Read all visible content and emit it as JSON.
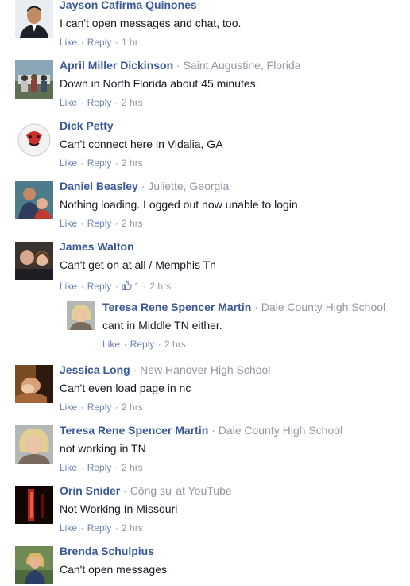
{
  "colors": {
    "author": "#3b5998",
    "meta": "#9197a3",
    "link": "#6d84b4",
    "text": "#141823"
  },
  "comments": [
    {
      "author": "Jayson Cafirma Quinones",
      "meta": "",
      "text": "I can't open messages and chat, too.",
      "like": "Like",
      "reply": "Reply",
      "time": "1 hr",
      "avatar": "man-in-suit"
    },
    {
      "author": "April Miller Dickinson",
      "meta": "Saint Augustine, Florida",
      "text": "Down in North Florida about 45 minutes.",
      "like": "Like",
      "reply": "Reply",
      "time": "2 hrs",
      "avatar": "outdoor-group"
    },
    {
      "author": "Dick Petty",
      "meta": "",
      "text": "Can't connect here in Vidalia, GA",
      "like": "Like",
      "reply": "Reply",
      "time": "2 hrs",
      "avatar": "volleyball-face"
    },
    {
      "author": "Daniel Beasley",
      "meta": "Juliette, Georgia",
      "text": "Nothing loading. Logged out now unable to login",
      "like": "Like",
      "reply": "Reply",
      "time": "2 hrs",
      "avatar": "man-with-child"
    },
    {
      "author": "James Walton",
      "meta": "",
      "text": "Can't get on at all / Memphis Tn",
      "like": "Like",
      "reply": "Reply",
      "time": "2 hrs",
      "avatar": "couple",
      "likes": "1"
    },
    {
      "author": "Jessica Long",
      "meta": "New Hanover High School",
      "text": "Can't even load page in nc",
      "like": "Like",
      "reply": "Reply",
      "time": "2 hrs",
      "avatar": "warm-photo"
    },
    {
      "author": "Teresa Rene Spencer Martin",
      "meta": "Dale County High School",
      "text": "not working in TN",
      "like": "Like",
      "reply": "Reply",
      "time": "2 hrs",
      "avatar": "blonde-woman"
    },
    {
      "author": "Orin Snider",
      "meta": "Cộng sự at YouTube",
      "text": "Not Working In Missouri",
      "like": "Like",
      "reply": "Reply",
      "time": "2 hrs",
      "avatar": "dark-red"
    },
    {
      "author": "Brenda Schulpius",
      "meta": "",
      "text": "Can't open messages",
      "like": "Like",
      "reply": "Reply",
      "time": "",
      "avatar": "woman-outdoors"
    }
  ],
  "reply": {
    "author": "Teresa Rene Spencer Martin",
    "meta": "Dale County High School",
    "text": "cant in Middle TN either.",
    "like": "Like",
    "reply": "Reply",
    "time": "2 hrs",
    "avatar": "blonde-woman"
  }
}
